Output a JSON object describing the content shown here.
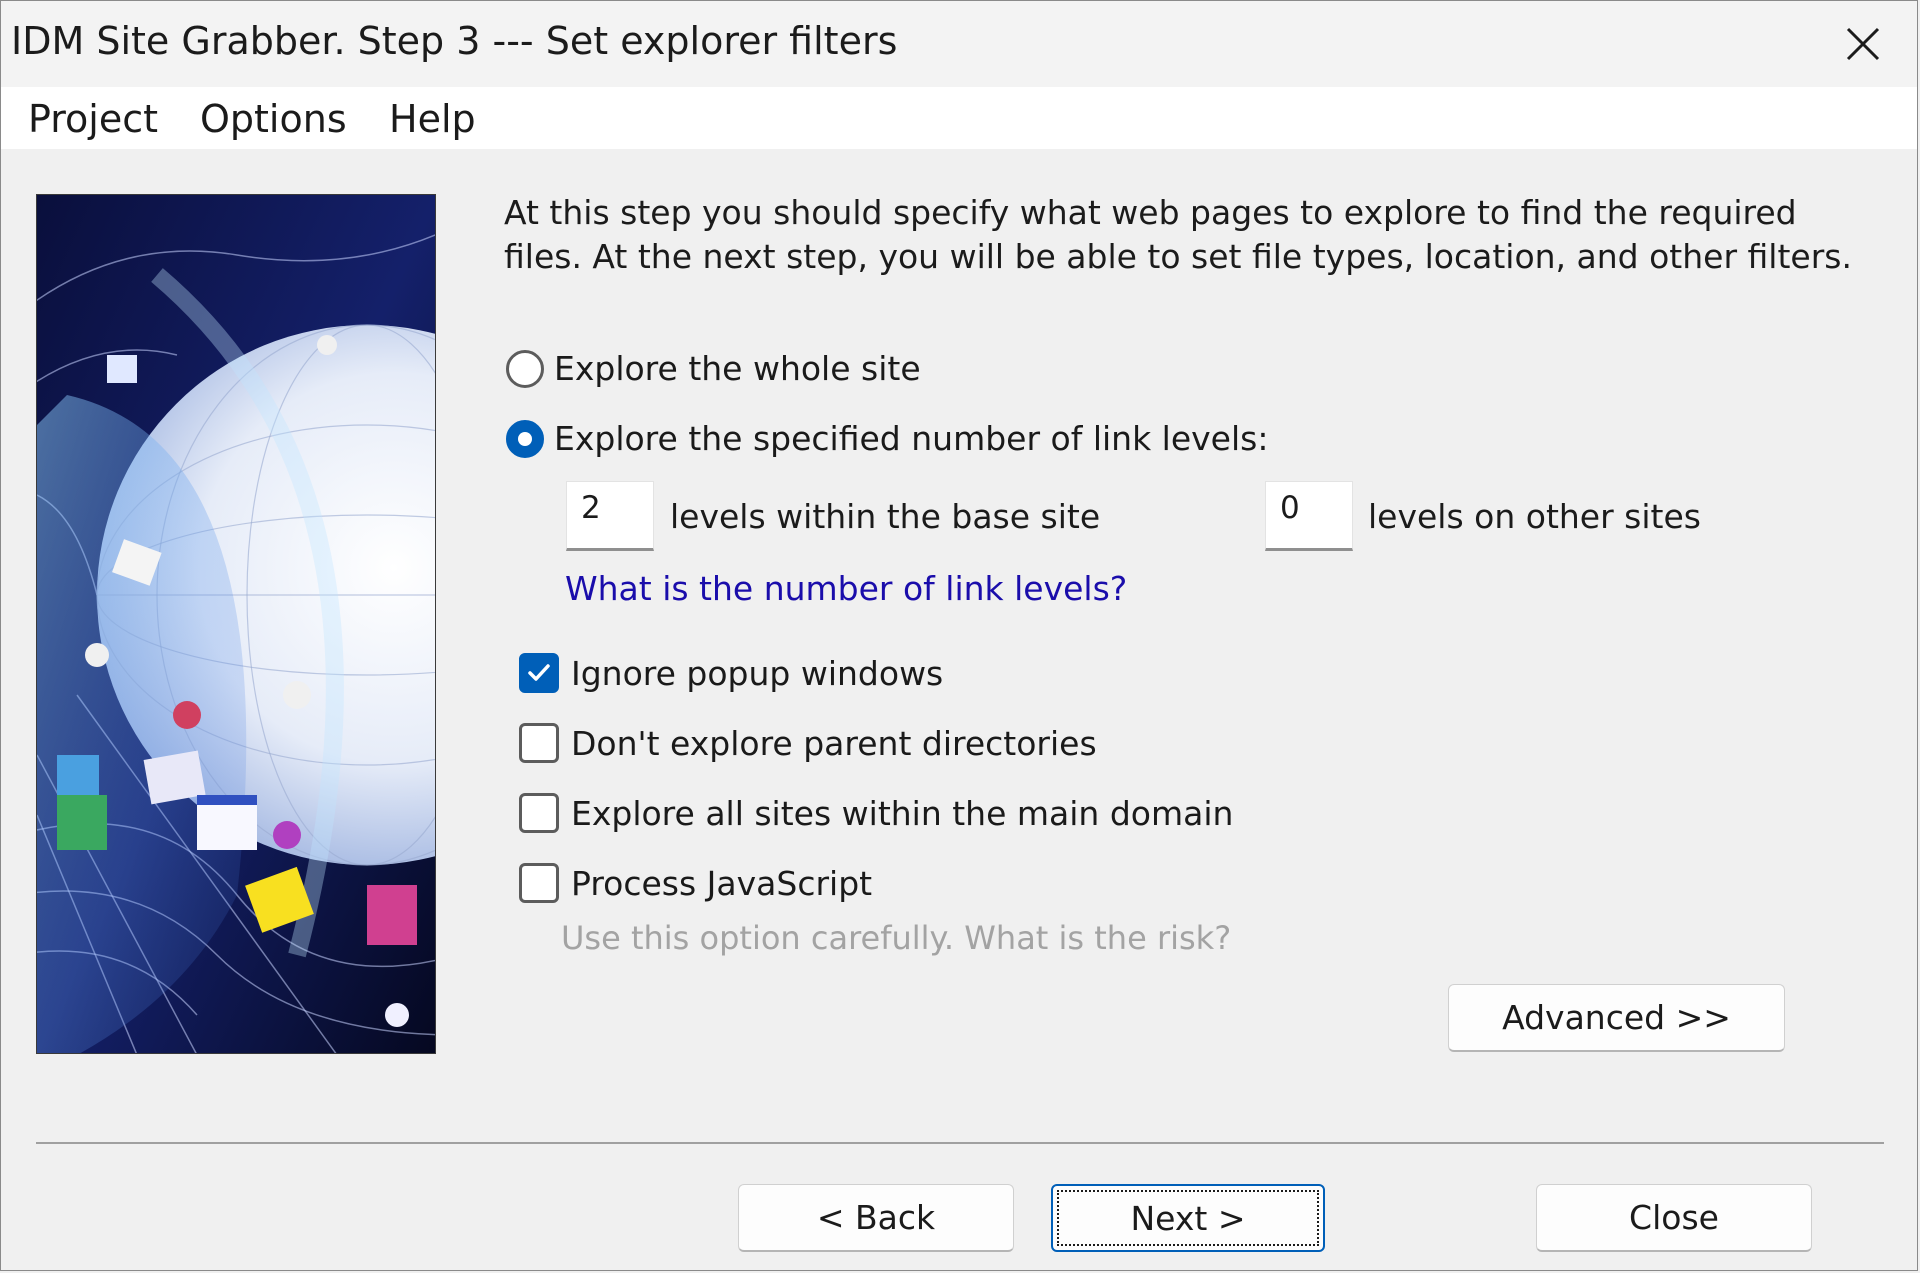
{
  "window": {
    "title": "IDM Site Grabber. Step 3 --- Set explorer filters",
    "close_glyph": "✕"
  },
  "menu": [
    "Project",
    "Options",
    "Help"
  ],
  "intro_text": "At this step you should specify what web pages to explore to find the required files. At the next step, you will be able to set file types, location, and other filters.",
  "explore": {
    "whole_site_label": "Explore the whole site",
    "whole_site_selected": false,
    "levels_label": "Explore the specified number of link levels:",
    "levels_selected": true,
    "base_site_levels": "2",
    "base_site_label": "levels within the base site",
    "other_sites_levels": "0",
    "other_sites_label": "levels on other sites",
    "help_link": "What is the number of link levels?"
  },
  "options": [
    {
      "label": "Ignore popup windows",
      "checked": true
    },
    {
      "label": "Don't explore parent directories",
      "checked": false
    },
    {
      "label": "Explore all sites within the main domain",
      "checked": false
    },
    {
      "label": "Process JavaScript",
      "checked": false
    }
  ],
  "js_hint": "Use this option carefully. What is the risk?",
  "buttons": {
    "advanced": "Advanced >>",
    "back": "< Back",
    "next": "Next >",
    "close": "Close"
  },
  "colors": {
    "accent": "#005fb8",
    "link": "#1a0dab",
    "hint": "#a3a3a3"
  }
}
